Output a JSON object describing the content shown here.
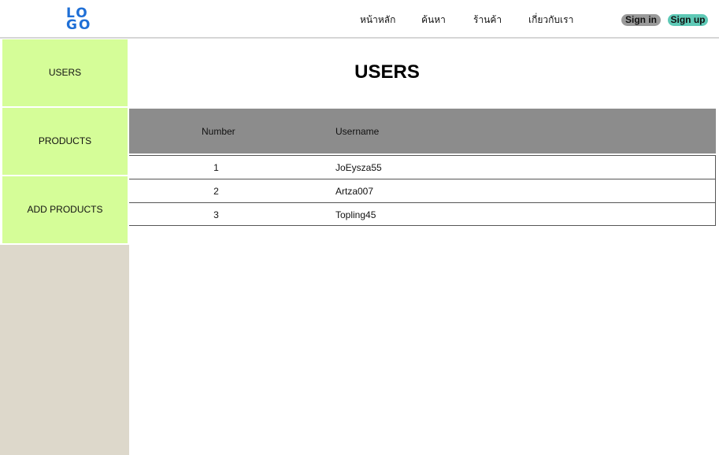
{
  "header": {
    "logo_top": "LO",
    "logo_bottom": "GO",
    "nav": [
      "หน้าหลัก",
      "ค้นหา",
      "ร้านค้า",
      "เกี่ยวกับเรา"
    ],
    "signin_label": "Sign in",
    "signup_label": "Sign up"
  },
  "sidebar": {
    "items": [
      {
        "label": "USERS"
      },
      {
        "label": "PRODUCTS"
      },
      {
        "label": "ADD PRODUCTS"
      }
    ]
  },
  "main": {
    "title": "USERS",
    "table": {
      "columns": [
        "Number",
        "Username"
      ],
      "rows": [
        {
          "number": "1",
          "username": "JoEysza55"
        },
        {
          "number": "2",
          "username": "Artza007"
        },
        {
          "number": "3",
          "username": "Topling45"
        }
      ]
    }
  },
  "colors": {
    "sidebar_item": "#d5fd98",
    "sidebar_filler": "#ddd8cb",
    "table_header": "#8c8c8c",
    "signin_button": "#9a9a9a",
    "signup_button": "#5ec9b6",
    "logo": "#1f6fd6"
  }
}
